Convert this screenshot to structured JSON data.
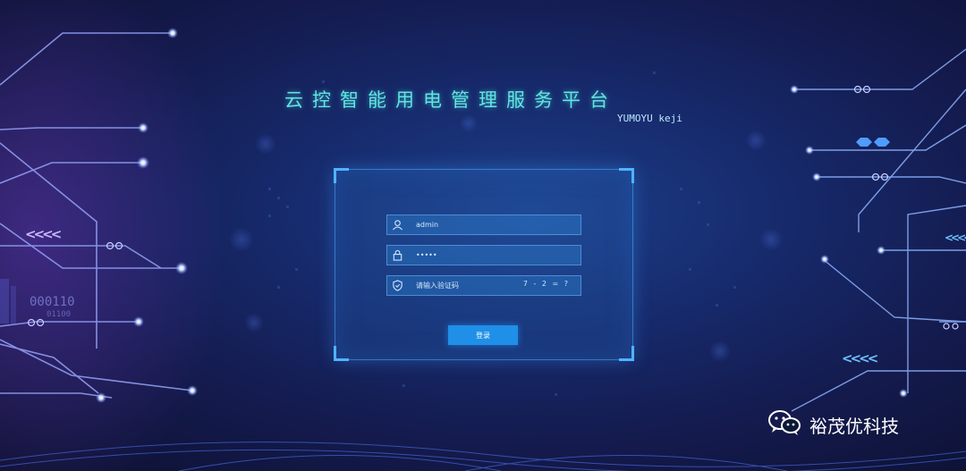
{
  "header": {
    "title": "云控智能用电管理服务平台",
    "subtitle": "YUMOYU keji"
  },
  "login": {
    "username_value": "admin",
    "password_value": "•••••",
    "captcha_placeholder": "请输入验证码",
    "captcha_code": "7 - 2 = ?",
    "submit_label": "登录"
  },
  "decor": {
    "left_numbers_top": "000110",
    "left_numbers_bottom": "01100",
    "chevrons": "<<<<"
  },
  "watermark": {
    "text": "裕茂优科技",
    "icon": "wechat-icon"
  },
  "colors": {
    "title": "#5fe6e0",
    "accent": "#1f8fe8",
    "glow": "#9fd6ff"
  }
}
